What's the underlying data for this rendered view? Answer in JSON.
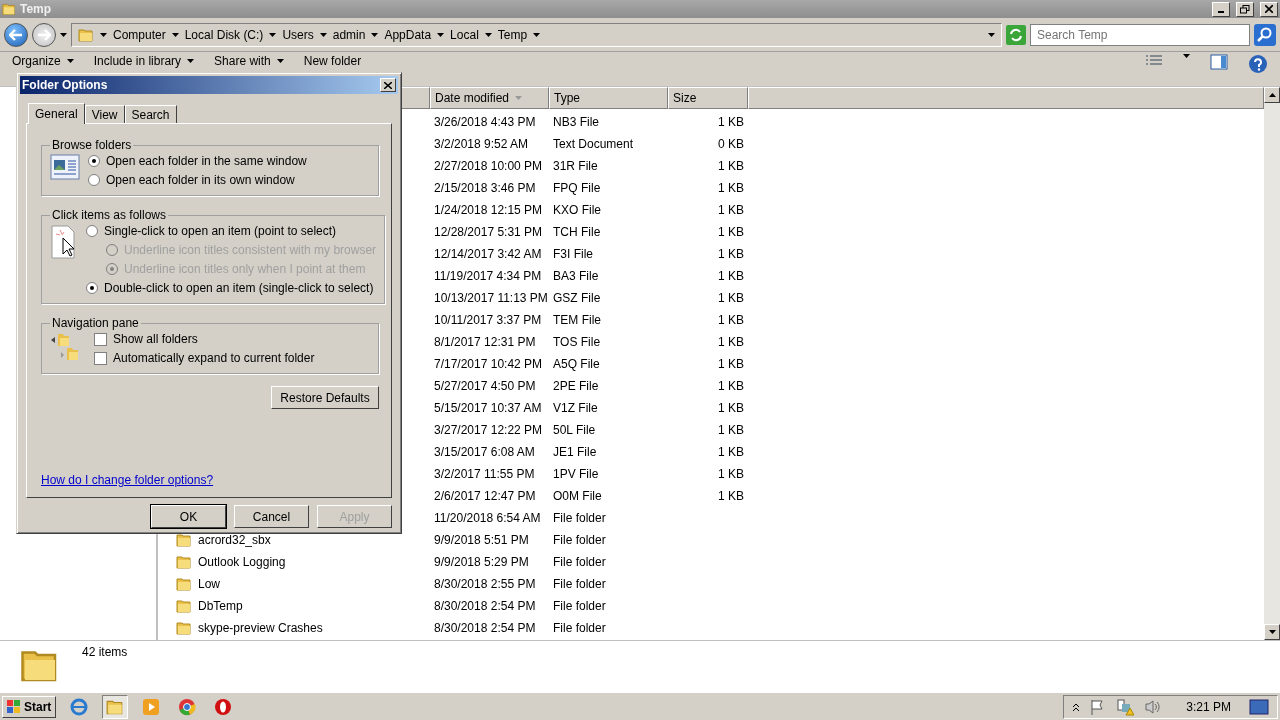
{
  "window": {
    "title": "Temp"
  },
  "address_bar": {
    "breadcrumbs": [
      "Computer",
      "Local Disk (C:)",
      "Users",
      "admin",
      "AppData",
      "Local",
      "Temp"
    ]
  },
  "search": {
    "placeholder": "Search Temp"
  },
  "toolbar": {
    "items": [
      {
        "label": "Organize",
        "dropdown": true
      },
      {
        "label": "Include in library",
        "dropdown": true
      },
      {
        "label": "Share with",
        "dropdown": true
      },
      {
        "label": "New folder",
        "dropdown": false
      }
    ]
  },
  "file_list": {
    "columns": [
      {
        "label": "Date modified",
        "sorted": true
      },
      {
        "label": "Type",
        "sorted": false
      },
      {
        "label": "Size",
        "sorted": false
      }
    ],
    "rows": [
      {
        "kind": "file",
        "date": "3/26/2018 4:43 PM",
        "type": "NB3 File",
        "size": "1 KB"
      },
      {
        "kind": "file",
        "date": "3/2/2018 9:52 AM",
        "type": "Text Document",
        "size": "0 KB"
      },
      {
        "kind": "file",
        "date": "2/27/2018 10:00 PM",
        "type": "31R File",
        "size": "1 KB"
      },
      {
        "kind": "file",
        "date": "2/15/2018 3:46 PM",
        "type": "FPQ File",
        "size": "1 KB"
      },
      {
        "kind": "file",
        "date": "1/24/2018 12:15 PM",
        "type": "KXO File",
        "size": "1 KB"
      },
      {
        "kind": "file",
        "date": "12/28/2017 5:31 PM",
        "type": "TCH File",
        "size": "1 KB"
      },
      {
        "kind": "file",
        "date": "12/14/2017 3:42 AM",
        "type": "F3I File",
        "size": "1 KB"
      },
      {
        "kind": "file",
        "date": "11/19/2017 4:34 PM",
        "type": "BA3 File",
        "size": "1 KB"
      },
      {
        "kind": "file",
        "date": "10/13/2017 11:13 PM",
        "type": "GSZ File",
        "size": "1 KB"
      },
      {
        "kind": "file",
        "date": "10/11/2017 3:37 PM",
        "type": "TEM File",
        "size": "1 KB"
      },
      {
        "kind": "file",
        "date": "8/1/2017 12:31 PM",
        "type": "TOS File",
        "size": "1 KB"
      },
      {
        "kind": "file",
        "date": "7/17/2017 10:42 PM",
        "type": "A5Q File",
        "size": "1 KB"
      },
      {
        "kind": "file",
        "date": "5/27/2017 4:50 PM",
        "type": "2PE File",
        "size": "1 KB"
      },
      {
        "kind": "file",
        "date": "5/15/2017 10:37 AM",
        "type": "V1Z File",
        "size": "1 KB"
      },
      {
        "kind": "file",
        "date": "3/27/2017 12:22 PM",
        "type": "50L File",
        "size": "1 KB"
      },
      {
        "kind": "file",
        "date": "3/15/2017 6:08 AM",
        "type": "JE1 File",
        "size": "1 KB"
      },
      {
        "kind": "file",
        "date": "3/2/2017 11:55 PM",
        "type": "1PV File",
        "size": "1 KB"
      },
      {
        "kind": "file",
        "date": "2/6/2017 12:47 PM",
        "type": "O0M File",
        "size": "1 KB"
      },
      {
        "date": "11/20/2018 6:54 AM",
        "type": "File folder"
      },
      {
        "kind": "folder",
        "name": "acrord32_sbx",
        "date": "9/9/2018 5:51 PM",
        "type": "File folder"
      },
      {
        "kind": "folder",
        "name": "Outlook Logging",
        "date": "9/9/2018 5:29 PM",
        "type": "File folder"
      },
      {
        "kind": "folder",
        "name": "Low",
        "date": "8/30/2018 2:55 PM",
        "type": "File folder"
      },
      {
        "kind": "folder",
        "name": "DbTemp",
        "date": "8/30/2018 2:54 PM",
        "type": "File folder"
      },
      {
        "kind": "folder",
        "name": "skype-preview Crashes",
        "date": "8/30/2018 2:54 PM",
        "type": "File folder"
      }
    ]
  },
  "details_pane": {
    "count": "42 items"
  },
  "dialog": {
    "title": "Folder Options",
    "tabs": [
      {
        "label": "General",
        "selected": true
      },
      {
        "label": "View",
        "selected": false
      },
      {
        "label": "Search",
        "selected": false
      }
    ],
    "groups": [
      {
        "title": "Browse folders",
        "kind": "browse",
        "options": [
          {
            "kind": "radio",
            "label": "Open each folder in the same window",
            "selected": true,
            "disabled": false
          },
          {
            "kind": "radio",
            "label": "Open each folder in its own window",
            "selected": false,
            "disabled": false
          }
        ]
      },
      {
        "title": "Click items as follows",
        "kind": "click",
        "options": [
          {
            "kind": "radio",
            "label": "Single-click to open an item (point to select)",
            "selected": false,
            "disabled": false,
            "children": [
              {
                "kind": "radio",
                "label": "Underline icon titles consistent with my browser",
                "selected": false,
                "disabled": true
              },
              {
                "kind": "radio",
                "label": "Underline icon titles only when I point at them",
                "selected": true,
                "disabled": true
              }
            ]
          },
          {
            "kind": "radio",
            "label": "Double-click to open an item (single-click to select)",
            "selected": true,
            "disabled": false
          }
        ]
      },
      {
        "title": "Navigation pane",
        "kind": "nav",
        "options": [
          {
            "kind": "checkbox",
            "label": "Show all folders",
            "checked": false,
            "disabled": false
          },
          {
            "kind": "checkbox",
            "label": "Automatically expand to current folder",
            "checked": false,
            "disabled": false
          }
        ]
      }
    ],
    "restore_button": "Restore Defaults",
    "help_link": "How do I change folder options?",
    "buttons": [
      {
        "label": "OK",
        "default": true,
        "disabled": false
      },
      {
        "label": "Cancel",
        "default": false,
        "disabled": false
      },
      {
        "label": "Apply",
        "default": false,
        "disabled": true
      }
    ]
  },
  "taskbar": {
    "start": "Start",
    "clock": "3:21 PM"
  }
}
